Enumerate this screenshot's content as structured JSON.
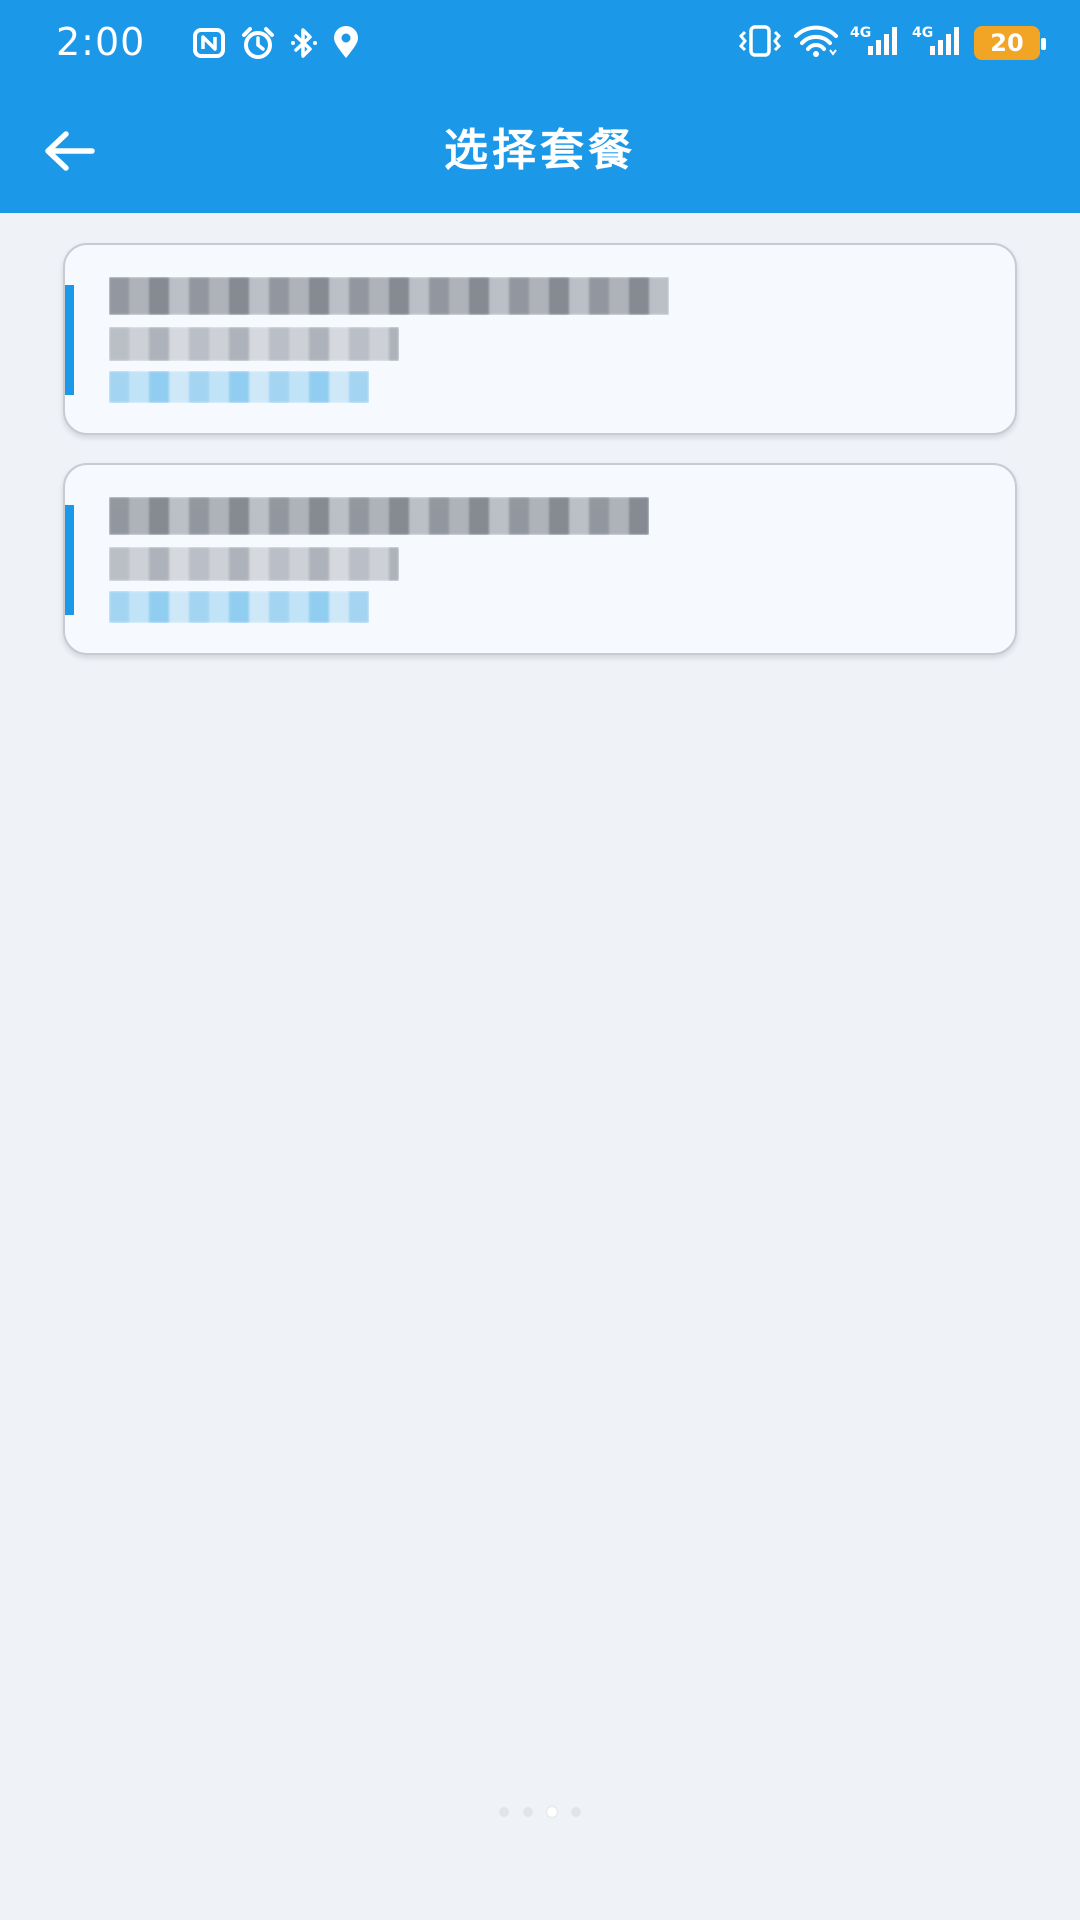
{
  "status_bar": {
    "time": "2:00",
    "left_icons": [
      "nfc-icon",
      "alarm-icon",
      "bluetooth-icon",
      "location-icon"
    ],
    "right_icons": [
      "vibrate-icon",
      "wifi-icon",
      "signal-4g-icon",
      "signal-4g-icon"
    ],
    "signal_labels": [
      "4G",
      "4G"
    ],
    "battery_level": "20",
    "colors": {
      "battery": "#f2a524",
      "bar": "#1c98e8"
    }
  },
  "header": {
    "back_icon": "back-arrow-icon",
    "title": "选择套餐"
  },
  "packages": [
    {
      "title": "",
      "subtitle": "",
      "price": "",
      "redacted": true
    },
    {
      "title": "",
      "subtitle": "",
      "price": "",
      "redacted": true
    }
  ],
  "page_indicator": {
    "count": 4,
    "active_index": 2
  },
  "colors": {
    "accent": "#1c98e8",
    "background": "#eff3f8",
    "card": "#f6f9fe"
  }
}
